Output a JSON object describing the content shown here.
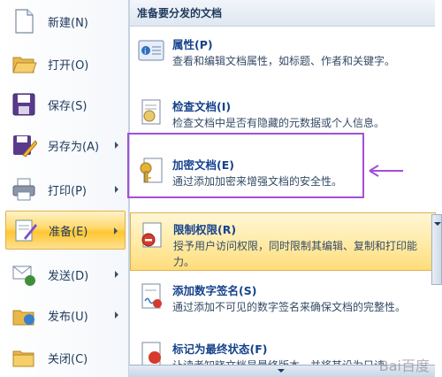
{
  "left_menu": {
    "items": [
      {
        "label": "新建(N)",
        "icon": "new-document-icon",
        "arrow": false
      },
      {
        "label": "打开(O)",
        "icon": "open-folder-icon",
        "arrow": false
      },
      {
        "label": "保存(S)",
        "icon": "save-disk-icon",
        "arrow": false
      },
      {
        "label": "另存为(A)",
        "icon": "save-as-icon",
        "arrow": true
      },
      {
        "label": "打印(P)",
        "icon": "printer-icon",
        "arrow": true
      },
      {
        "label": "准备(E)",
        "icon": "prepare-icon",
        "arrow": true
      },
      {
        "label": "发送(D)",
        "icon": "send-icon",
        "arrow": true
      },
      {
        "label": "发布(U)",
        "icon": "publish-icon",
        "arrow": true
      },
      {
        "label": "关闭(C)",
        "icon": "close-folder-icon",
        "arrow": false
      }
    ]
  },
  "panel": {
    "header": "准备要分发的文档",
    "entries": [
      {
        "title": "属性(P)",
        "desc": "查看和编辑文档属性，如标题、作者和关键字。",
        "icon": "properties-icon"
      },
      {
        "title": "检查文档(I)",
        "desc": "检查文档中是否有隐藏的元数据或个人信息。",
        "icon": "inspect-document-icon"
      },
      {
        "title": "加密文档(E)",
        "desc": "通过添加加密来增强文档的安全性。",
        "icon": "encrypt-key-icon"
      },
      {
        "title": "限制权限(R)",
        "desc": "授予用户访问权限，同时限制其编辑、复制和打印能力。",
        "icon": "restrict-permission-icon"
      },
      {
        "title": "添加数字签名(S)",
        "desc": "通过添加不可见的数字签名来确保文档的完整性。",
        "icon": "digital-signature-icon"
      },
      {
        "title": "标记为最终状态(F)",
        "desc": "让读者知晓文档是最终版本，并将其设为只读。",
        "icon": "mark-final-icon"
      }
    ]
  },
  "colors": {
    "accent_purple": "#a34fd6",
    "highlight_orange": "#ffc631"
  },
  "watermark": "Bai百度"
}
